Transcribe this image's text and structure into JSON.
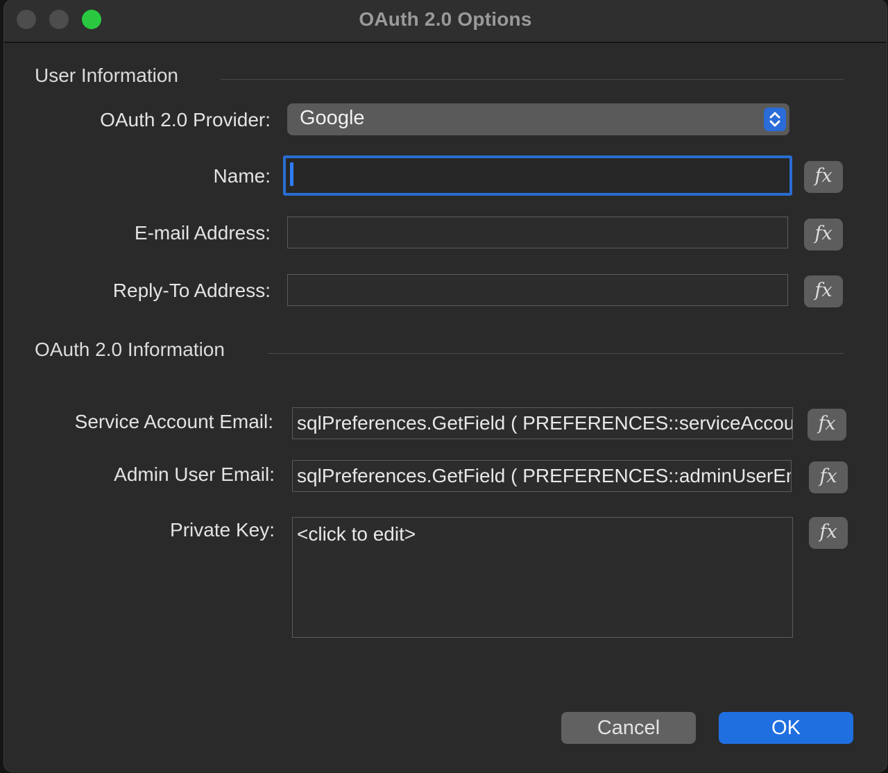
{
  "window": {
    "title": "OAuth 2.0 Options"
  },
  "user_info": {
    "header": "User Information",
    "provider_label": "OAuth 2.0 Provider:",
    "provider_value": "Google",
    "name_label": "Name:",
    "name_value": "",
    "email_label": "E-mail Address:",
    "email_value": "",
    "reply_label": "Reply-To Address:",
    "reply_value": ""
  },
  "oauth_info": {
    "header": "OAuth 2.0 Information",
    "service_label": "Service Account Email:",
    "service_value": "sqlPreferences.GetField ( PREFERENCES::serviceAccountEmail )",
    "admin_label": "Admin User Email:",
    "admin_value": "sqlPreferences.GetField ( PREFERENCES::adminUserEmail )",
    "key_label": "Private Key:",
    "key_value": "<click to edit>"
  },
  "fx_label": "fx",
  "buttons": {
    "cancel": "Cancel",
    "ok": "OK"
  },
  "colors": {
    "accent": "#1f6fe0",
    "focus_ring": "#2a6dd1",
    "maximize": "#2ac840"
  },
  "icons": {
    "stepper": "chevron-up-down-icon",
    "caret": "text-cursor"
  }
}
